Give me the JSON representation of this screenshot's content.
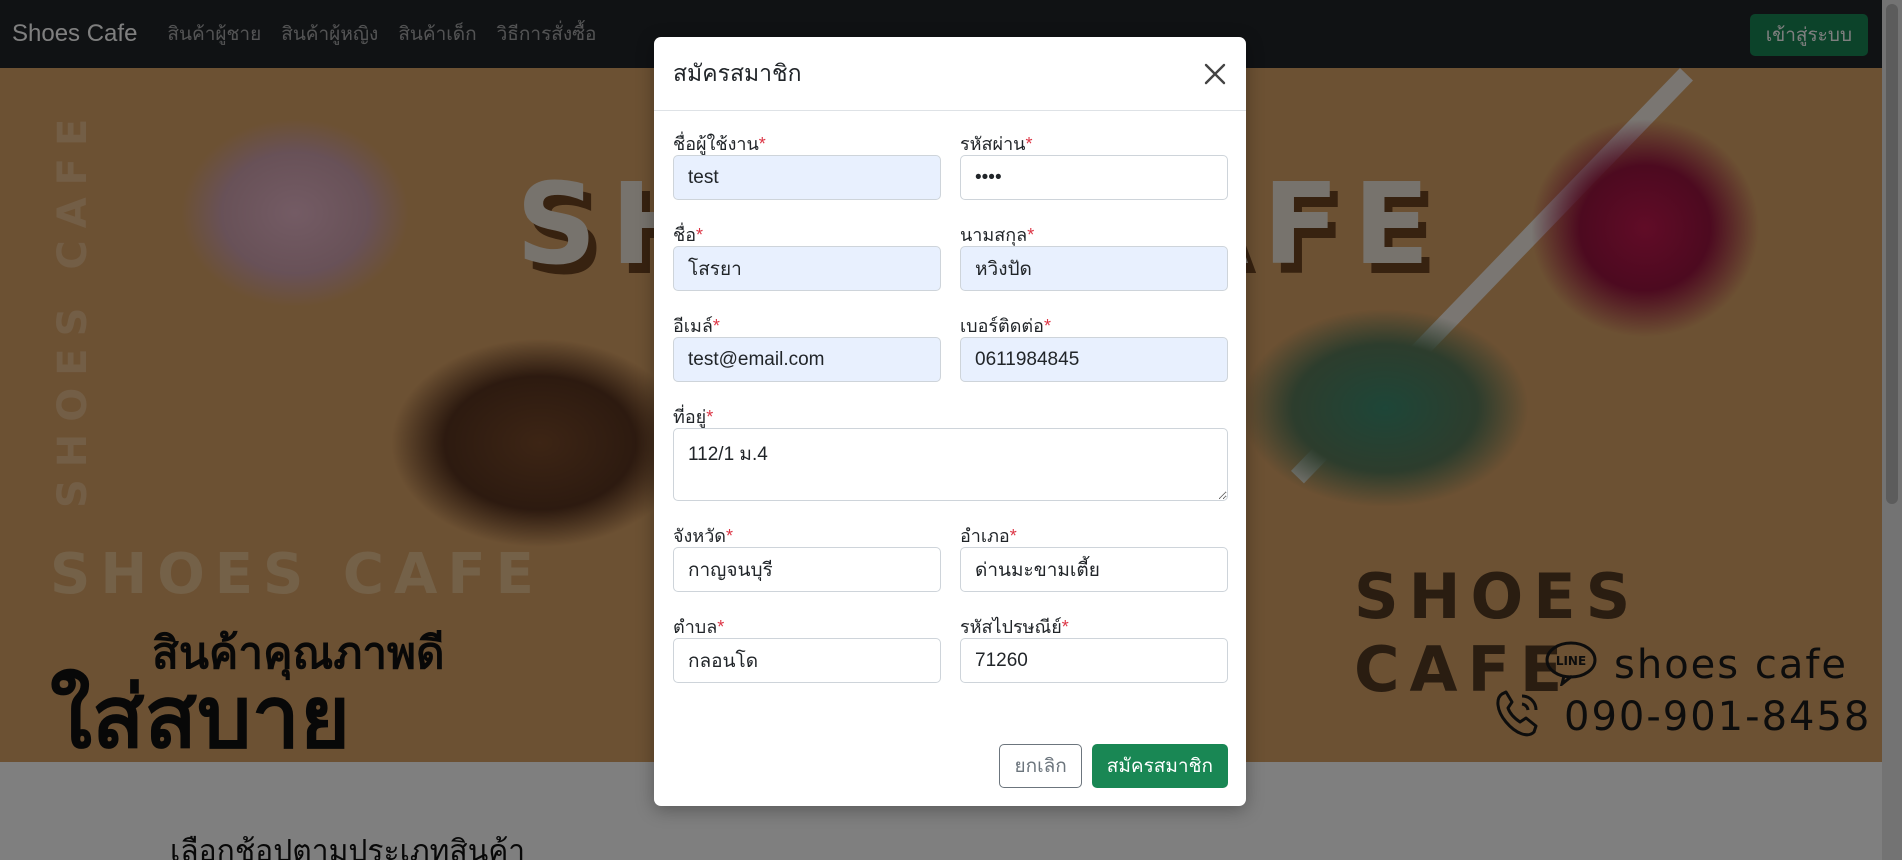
{
  "navbar": {
    "brand": "Shoes Cafe",
    "links": [
      "สินค้าผู้ชาย",
      "สินค้าผู้หญิง",
      "สินค้าเด็ก",
      "วิธีการสั่งซื้อ"
    ],
    "login_label": "เข้าสู่ระบบ"
  },
  "banner": {
    "big_word": "SHOES CAFE",
    "vertical_word": "SHOES CAFE",
    "left_word": "SHOES CAFE",
    "right_word": "SHOES CAFE",
    "slogan_line1": "สินค้าคุณภาพดี",
    "slogan_line2": "ใส่สบาย",
    "line_id": "shoes cafe",
    "phone": "090-901-8458",
    "colors": {
      "background": "#d9a266",
      "text_dark": "#111111"
    }
  },
  "section_title": "เลือกช้อปตามประเภทสินค้า",
  "modal": {
    "title": "สมัครสมาชิก",
    "required_mark": "*",
    "fields": {
      "username": {
        "label": "ชื่อผู้ใช้งาน",
        "value": "test"
      },
      "password": {
        "label": "รหัสผ่าน",
        "value": "test"
      },
      "firstname": {
        "label": "ชื่อ",
        "value": "โสรยา"
      },
      "lastname": {
        "label": "นามสกุล",
        "value": "หวิงปัด"
      },
      "email": {
        "label": "อีเมล์",
        "value": "test@email.com"
      },
      "phone": {
        "label": "เบอร์ติดต่อ",
        "value": "0611984845"
      },
      "address": {
        "label": "ที่อยู่",
        "value": "112/1 ม.4"
      },
      "province": {
        "label": "จังหวัด",
        "value": "กาญจนบุรี"
      },
      "district": {
        "label": "อำเภอ",
        "value": "ด่านมะขามเตี้ย"
      },
      "subdistrict": {
        "label": "ตำบล",
        "value": "กลอนโด"
      },
      "postcode": {
        "label": "รหัสไปรษณีย์",
        "value": "71260"
      }
    },
    "cancel_label": "ยกเลิก",
    "submit_label": "สมัครสมาชิก",
    "colors": {
      "accent": "#198754",
      "autofill": "#e8f0fe",
      "required": "#dc3545"
    }
  }
}
